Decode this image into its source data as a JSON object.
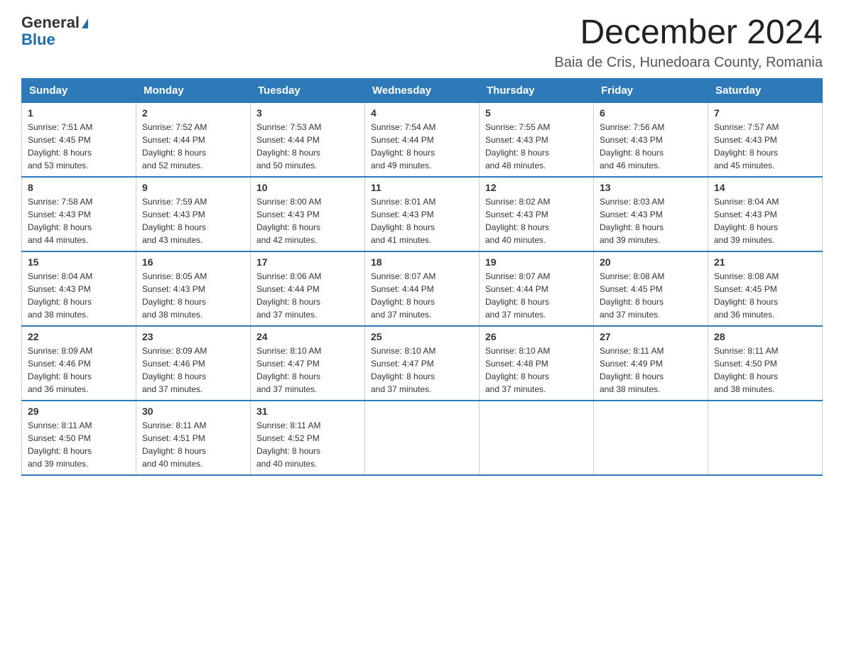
{
  "logo": {
    "general": "General",
    "triangle": "▶",
    "blue": "Blue"
  },
  "header": {
    "title": "December 2024",
    "subtitle": "Baia de Cris, Hunedoara County, Romania"
  },
  "days_of_week": [
    "Sunday",
    "Monday",
    "Tuesday",
    "Wednesday",
    "Thursday",
    "Friday",
    "Saturday"
  ],
  "weeks": [
    [
      {
        "day": "1",
        "sunrise": "7:51 AM",
        "sunset": "4:45 PM",
        "daylight": "8 hours and 53 minutes."
      },
      {
        "day": "2",
        "sunrise": "7:52 AM",
        "sunset": "4:44 PM",
        "daylight": "8 hours and 52 minutes."
      },
      {
        "day": "3",
        "sunrise": "7:53 AM",
        "sunset": "4:44 PM",
        "daylight": "8 hours and 50 minutes."
      },
      {
        "day": "4",
        "sunrise": "7:54 AM",
        "sunset": "4:44 PM",
        "daylight": "8 hours and 49 minutes."
      },
      {
        "day": "5",
        "sunrise": "7:55 AM",
        "sunset": "4:43 PM",
        "daylight": "8 hours and 48 minutes."
      },
      {
        "day": "6",
        "sunrise": "7:56 AM",
        "sunset": "4:43 PM",
        "daylight": "8 hours and 46 minutes."
      },
      {
        "day": "7",
        "sunrise": "7:57 AM",
        "sunset": "4:43 PM",
        "daylight": "8 hours and 45 minutes."
      }
    ],
    [
      {
        "day": "8",
        "sunrise": "7:58 AM",
        "sunset": "4:43 PM",
        "daylight": "8 hours and 44 minutes."
      },
      {
        "day": "9",
        "sunrise": "7:59 AM",
        "sunset": "4:43 PM",
        "daylight": "8 hours and 43 minutes."
      },
      {
        "day": "10",
        "sunrise": "8:00 AM",
        "sunset": "4:43 PM",
        "daylight": "8 hours and 42 minutes."
      },
      {
        "day": "11",
        "sunrise": "8:01 AM",
        "sunset": "4:43 PM",
        "daylight": "8 hours and 41 minutes."
      },
      {
        "day": "12",
        "sunrise": "8:02 AM",
        "sunset": "4:43 PM",
        "daylight": "8 hours and 40 minutes."
      },
      {
        "day": "13",
        "sunrise": "8:03 AM",
        "sunset": "4:43 PM",
        "daylight": "8 hours and 39 minutes."
      },
      {
        "day": "14",
        "sunrise": "8:04 AM",
        "sunset": "4:43 PM",
        "daylight": "8 hours and 39 minutes."
      }
    ],
    [
      {
        "day": "15",
        "sunrise": "8:04 AM",
        "sunset": "4:43 PM",
        "daylight": "8 hours and 38 minutes."
      },
      {
        "day": "16",
        "sunrise": "8:05 AM",
        "sunset": "4:43 PM",
        "daylight": "8 hours and 38 minutes."
      },
      {
        "day": "17",
        "sunrise": "8:06 AM",
        "sunset": "4:44 PM",
        "daylight": "8 hours and 37 minutes."
      },
      {
        "day": "18",
        "sunrise": "8:07 AM",
        "sunset": "4:44 PM",
        "daylight": "8 hours and 37 minutes."
      },
      {
        "day": "19",
        "sunrise": "8:07 AM",
        "sunset": "4:44 PM",
        "daylight": "8 hours and 37 minutes."
      },
      {
        "day": "20",
        "sunrise": "8:08 AM",
        "sunset": "4:45 PM",
        "daylight": "8 hours and 37 minutes."
      },
      {
        "day": "21",
        "sunrise": "8:08 AM",
        "sunset": "4:45 PM",
        "daylight": "8 hours and 36 minutes."
      }
    ],
    [
      {
        "day": "22",
        "sunrise": "8:09 AM",
        "sunset": "4:46 PM",
        "daylight": "8 hours and 36 minutes."
      },
      {
        "day": "23",
        "sunrise": "8:09 AM",
        "sunset": "4:46 PM",
        "daylight": "8 hours and 37 minutes."
      },
      {
        "day": "24",
        "sunrise": "8:10 AM",
        "sunset": "4:47 PM",
        "daylight": "8 hours and 37 minutes."
      },
      {
        "day": "25",
        "sunrise": "8:10 AM",
        "sunset": "4:47 PM",
        "daylight": "8 hours and 37 minutes."
      },
      {
        "day": "26",
        "sunrise": "8:10 AM",
        "sunset": "4:48 PM",
        "daylight": "8 hours and 37 minutes."
      },
      {
        "day": "27",
        "sunrise": "8:11 AM",
        "sunset": "4:49 PM",
        "daylight": "8 hours and 38 minutes."
      },
      {
        "day": "28",
        "sunrise": "8:11 AM",
        "sunset": "4:50 PM",
        "daylight": "8 hours and 38 minutes."
      }
    ],
    [
      {
        "day": "29",
        "sunrise": "8:11 AM",
        "sunset": "4:50 PM",
        "daylight": "8 hours and 39 minutes."
      },
      {
        "day": "30",
        "sunrise": "8:11 AM",
        "sunset": "4:51 PM",
        "daylight": "8 hours and 40 minutes."
      },
      {
        "day": "31",
        "sunrise": "8:11 AM",
        "sunset": "4:52 PM",
        "daylight": "8 hours and 40 minutes."
      },
      null,
      null,
      null,
      null
    ]
  ],
  "labels": {
    "sunrise": "Sunrise:",
    "sunset": "Sunset:",
    "daylight": "Daylight:"
  }
}
